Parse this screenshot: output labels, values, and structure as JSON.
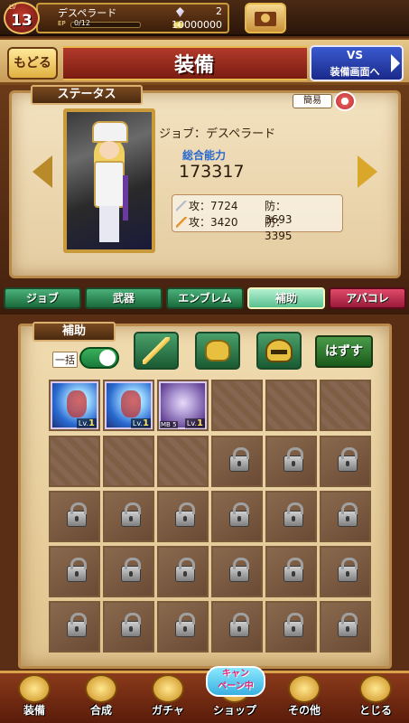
{
  "player": {
    "level_caption": "LV",
    "level": "13",
    "name": "デスペラード",
    "exp_caption": "EP",
    "exp_text": "0/12",
    "exp_progress": 0.0,
    "gems": "2",
    "coins": "10000000"
  },
  "header": {
    "back_label": "もどる",
    "title": "装備",
    "vs_line1": "VS",
    "vs_line2": "装備画面へ"
  },
  "status": {
    "tag": "ステータス",
    "simple_label": "簡易",
    "job_line": "ジョブ：デスペラード",
    "power_label": "総合能力",
    "power_value": "173317",
    "row1_attack": "攻：7724",
    "row1_defense": "防：3693",
    "row2_attack": "攻：3420",
    "row2_defense": "防：3395"
  },
  "tabs": [
    {
      "label": "ジョブ"
    },
    {
      "label": "武器"
    },
    {
      "label": "エンブレム"
    },
    {
      "label": "補助"
    },
    {
      "label": "アバコレ"
    }
  ],
  "items": {
    "tag": "補助",
    "bulk_label": "一括",
    "remove_label": "はずす",
    "card_level_caption": "Lv.",
    "card1_level": "1",
    "card2_level": "1",
    "card3_level": "1",
    "card3_mb": "MB 5"
  },
  "nav": [
    {
      "label": "装備"
    },
    {
      "label": "合成"
    },
    {
      "label": "ガチャ"
    },
    {
      "label": "ショップ"
    },
    {
      "label": "その他"
    },
    {
      "label": "とじる"
    }
  ],
  "campaign": {
    "line1": "キャン",
    "line2": "ペーン中"
  }
}
